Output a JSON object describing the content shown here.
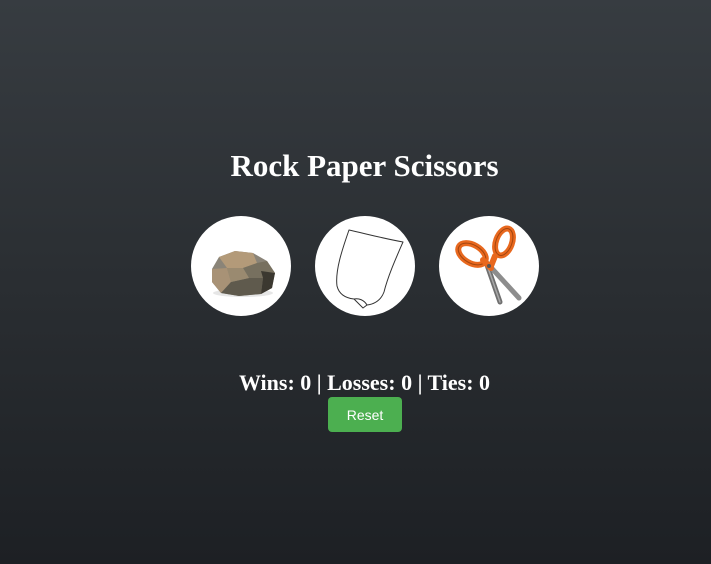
{
  "game": {
    "title": "Rock Paper Scissors",
    "choices": [
      {
        "id": "rock",
        "icon": "rock-icon"
      },
      {
        "id": "paper",
        "icon": "paper-icon"
      },
      {
        "id": "scissors",
        "icon": "scissors-icon"
      }
    ],
    "score": {
      "wins": 0,
      "losses": 0,
      "ties": 0,
      "text": "Wins: 0 | Losses: 0 | Ties: 0"
    },
    "reset_label": "Reset"
  },
  "colors": {
    "background_top": "#373c41",
    "background_bottom": "#1d2024",
    "button": "#4caf50",
    "text": "#ffffff"
  }
}
